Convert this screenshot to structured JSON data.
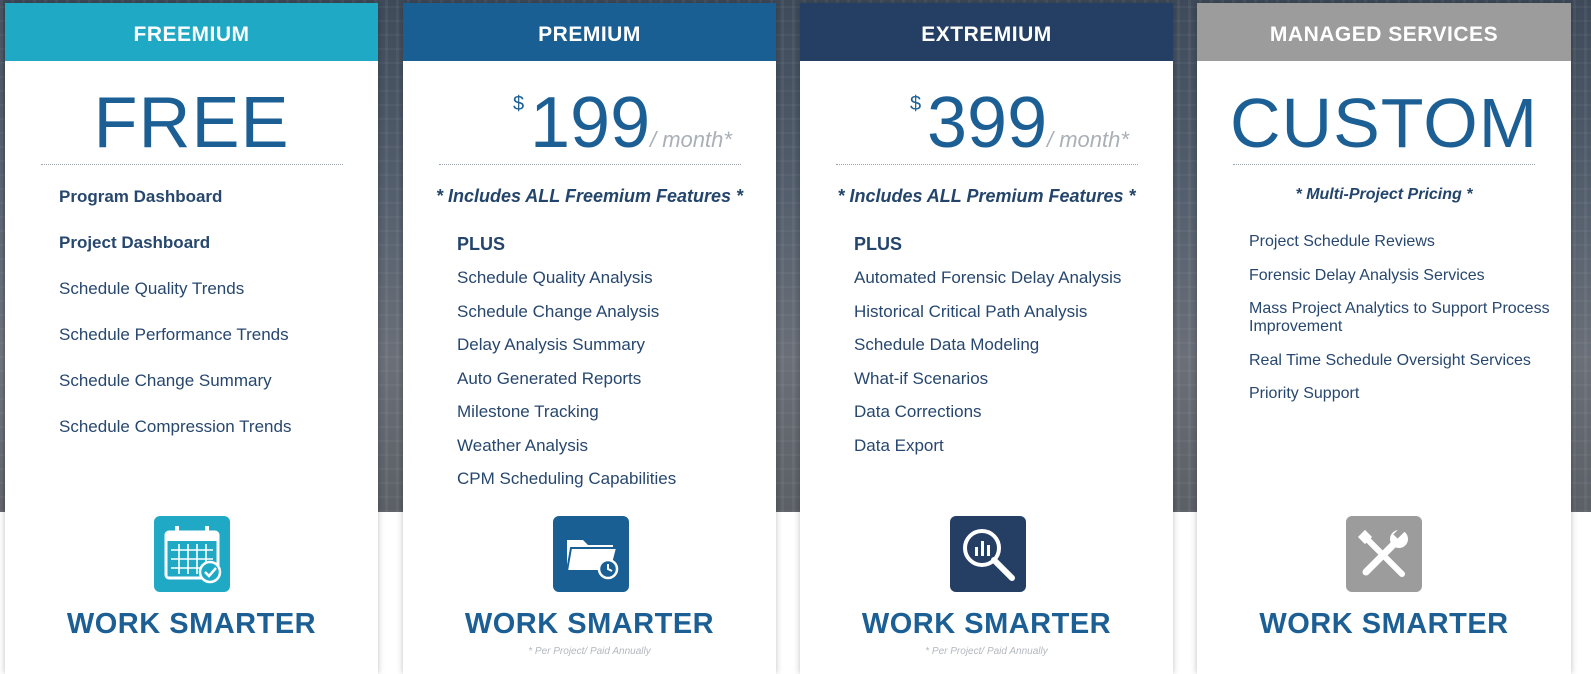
{
  "colors": {
    "freemium": "#1fa9c4",
    "premium": "#195f94",
    "extremium": "#243f63",
    "managed": "#9c9c9c",
    "text_blue": "#1b5f95",
    "text_navy": "#27476e"
  },
  "freemium": {
    "header": "FREEMIUM",
    "price": "FREE",
    "features_bold": [
      "Program Dashboard",
      "Project Dashboard"
    ],
    "features": [
      "Schedule Quality Trends",
      "Schedule Performance Trends",
      "Schedule Change Summary",
      "Schedule Compression Trends"
    ],
    "icon": "calendar-check-icon",
    "tagline": "WORK SMARTER"
  },
  "premium": {
    "header": "PREMIUM",
    "currency": "$",
    "amount": "199",
    "period": "/ month*",
    "includes": "* Includes ALL Freemium Features *",
    "plus": "PLUS",
    "features": [
      "Schedule Quality Analysis",
      "Schedule Change Analysis",
      "Delay Analysis Summary",
      "Auto Generated Reports",
      "Milestone Tracking",
      "Weather Analysis",
      "CPM Scheduling Capabilities"
    ],
    "icon": "folder-clock-icon",
    "tagline": "WORK SMARTER",
    "note": "* Per Project/ Paid Annually"
  },
  "extremium": {
    "header": "EXTREMIUM",
    "currency": "$",
    "amount": "399",
    "period": "/ month*",
    "includes": "* Includes ALL Premium Features *",
    "plus": "PLUS",
    "features": [
      "Automated Forensic Delay Analysis",
      "Historical Critical Path Analysis",
      "Schedule Data Modeling",
      "What-if Scenarios",
      "Data Corrections",
      "Data Export"
    ],
    "icon": "magnifier-chart-icon",
    "tagline": "WORK SMARTER",
    "note": "* Per Project/ Paid Annually"
  },
  "managed": {
    "header": "MANAGED SERVICES",
    "price": "CUSTOM",
    "includes": "* Multi-Project Pricing *",
    "features": [
      "Project Schedule Reviews",
      "Forensic Delay Analysis Services",
      "Mass Project Analytics to Support Process Improvement",
      "Real Time Schedule Oversight Services",
      "Priority Support"
    ],
    "icon": "tools-icon",
    "tagline": "WORK SMARTER"
  }
}
